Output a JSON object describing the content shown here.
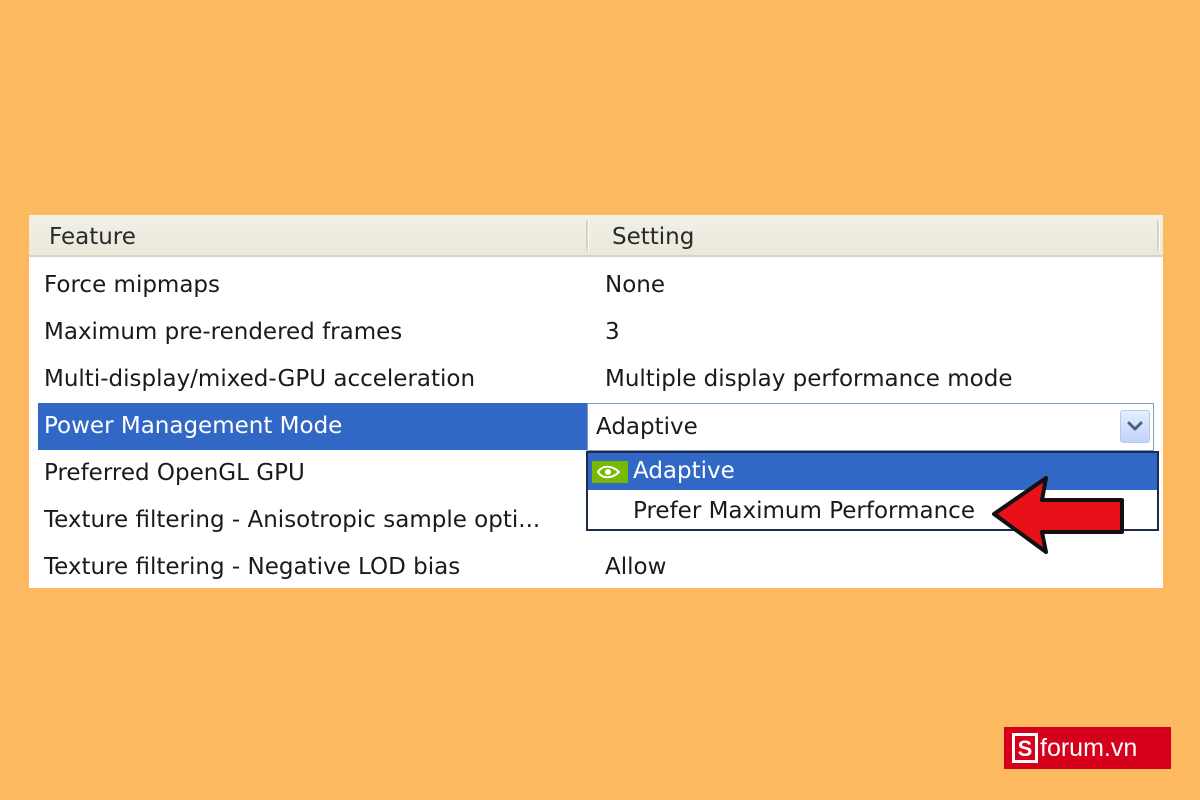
{
  "table": {
    "headers": {
      "feature": "Feature",
      "setting": "Setting"
    },
    "rows": [
      {
        "feature": "Force mipmaps",
        "setting": "None"
      },
      {
        "feature": "Maximum pre-rendered frames",
        "setting": "3"
      },
      {
        "feature": "Multi-display/mixed-GPU acceleration",
        "setting": "Multiple display performance mode"
      },
      {
        "feature": "Power Management Mode",
        "setting": "Adaptive",
        "selected": true
      },
      {
        "feature": "Preferred OpenGL GPU",
        "setting": ""
      },
      {
        "feature": "Texture filtering - Anisotropic sample opti...",
        "setting": ""
      },
      {
        "feature": "Texture filtering - Negative LOD bias",
        "setting": "Allow"
      }
    ]
  },
  "combo": {
    "value": "Adaptive",
    "icon": "chevron-down-icon"
  },
  "dropdown": {
    "options": [
      {
        "label": "Adaptive",
        "highlighted": true,
        "icon": "nvidia-icon"
      },
      {
        "label": "Prefer Maximum Performance",
        "highlighted": false
      }
    ]
  },
  "annotation": {
    "icon": "red-arrow-icon",
    "color": "#E8111A"
  },
  "watermark": {
    "text": "forum.vn",
    "letter": "S",
    "color": "#D6001C"
  },
  "colors": {
    "background": "#FDB960",
    "selection": "#3268C5"
  }
}
